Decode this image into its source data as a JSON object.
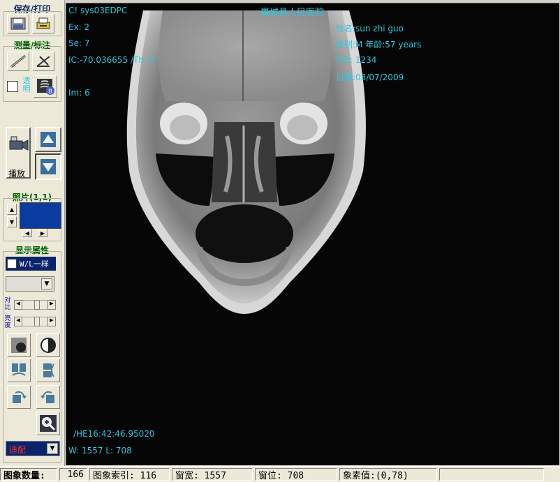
{
  "sidebar": {
    "save_print_title": "保存/打印",
    "measure_title": "测量/标注",
    "transparent_label": "透明",
    "play_label": "播放",
    "photo_title": "照片(1,1)",
    "display_title": "显示属性",
    "wl_same_label": "W/L一样",
    "contrast_label": "对比",
    "brightness_label": "亮度",
    "fit_select_value": "适配",
    "icons": {
      "save": "save-icon",
      "print": "print-icon",
      "ruler": "ruler-icon",
      "angle": "angle-icon",
      "xray": "xray-icon",
      "camera": "video-camera-icon",
      "up": "arrow-up-icon",
      "down": "arrow-down-icon",
      "invert": "invert-icon",
      "contrast": "contrast-icon",
      "flip_h": "flip-horizontal-icon",
      "flip_v": "flip-vertical-icon",
      "rotate_cw": "rotate-cw-icon",
      "rotate_ccw": "rotate-ccw-icon",
      "zoom": "zoom-icon"
    }
  },
  "overlay": {
    "station": "C! sys03EDPC",
    "hospital": "襄城县人民医院",
    "exam": "Ex: 2",
    "series": "Se: 7",
    "position": "IC:-70.036655 /Th: 4",
    "image_num": "Im: 6",
    "patient_name": "姓名:sun zhi guo",
    "patient_sex_age": "性别:M  年龄:57 years",
    "patient_id": "PID: 1234",
    "study_date": "日期:03/07/2009",
    "time": "/HE16:42:46.95020",
    "window_level": "W: 1557 L: 708"
  },
  "status": {
    "image_count_label": "图象数量:",
    "image_count": "166",
    "image_index": "图象索引: 116",
    "window_width": "窗宽: 1557",
    "window_pos": "窗位: 708",
    "pixel_value": "象素值:(0,78)"
  },
  "colors": {
    "overlay_text": "#2ec8e0",
    "selected_photo": "#0a3ca0",
    "viewport_bg": "#050505"
  }
}
